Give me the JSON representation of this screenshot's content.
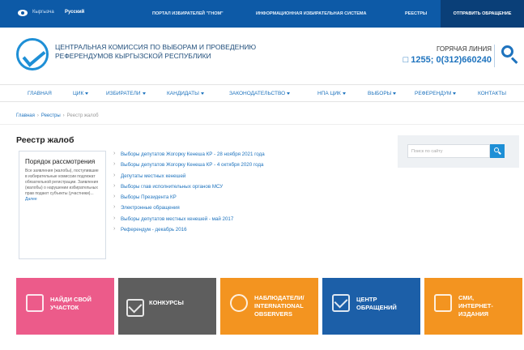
{
  "topbar": {
    "languages": [
      "Кыргызча",
      "Русский"
    ],
    "active_language": "Русский",
    "links": [
      "ПОРТАЛ ИЗБИРАТЕЛЕЙ \"ГНОМ\"",
      "ИНФОРМАЦИОННАЯ ИЗБИРАТЕЛЬНАЯ СИСТЕМА",
      "РЕЕСТРЫ"
    ],
    "send_button": "ОТПРАВИТЬ ОБРАЩЕНИЕ"
  },
  "header": {
    "org_name": "ЦЕНТРАЛЬНАЯ КОМИССИЯ ПО ВЫБОРАМ И ПРОВЕДЕНИЮ РЕФЕРЕНДУМОВ КЫРГЫЗСКОЙ РЕСПУБЛИКИ",
    "hotline_label": "ГОРЯЧАЯ ЛИНИЯ",
    "hotline_phone": "1255; 0(312)660240"
  },
  "nav": [
    {
      "label": "ГЛАВНАЯ",
      "dropdown": false
    },
    {
      "label": "ЦИК",
      "dropdown": true
    },
    {
      "label": "ИЗБИРАТЕЛИ",
      "dropdown": true
    },
    {
      "label": "КАНДИДАТЫ",
      "dropdown": true
    },
    {
      "label": "ЗАКОНОДАТЕЛЬСТВО",
      "dropdown": true
    },
    {
      "label": "НПА ЦИК",
      "dropdown": true
    },
    {
      "label": "ВЫБОРЫ",
      "dropdown": true
    },
    {
      "label": "РЕФЕРЕНДУМ",
      "dropdown": true
    },
    {
      "label": "КОНТАКТЫ",
      "dropdown": false
    }
  ],
  "breadcrumb": [
    "Главная",
    "Реестры",
    "Реестр жалоб"
  ],
  "page_title": "Реестр жалоб",
  "procedure": {
    "title": "Порядок рассмотрения",
    "text": "Все заявления (жалобы), поступившие в избирательные комиссии подлежат обязательной регистрации. Заявления (жалобы) о нарушении избирательных прав подают субъекты (участники)...",
    "more": "Далее"
  },
  "elections": [
    "Выборы депутатов Жогорку Кенеша КР - 28 ноября 2021 года",
    "Выборы депутатов Жогорку Кенеша КР - 4 октября 2020 года",
    "Депутаты местных кенешей",
    "Выборы глав исполнительных органов МСУ",
    "Выборы Президента КР",
    "Электронные обращения",
    "Выборы депутатов местных кенешей - май 2017",
    "Референдум - декабрь 2016"
  ],
  "search": {
    "placeholder": "Поиск по сайту"
  },
  "tiles": [
    {
      "label": "НАЙДИ СВОЙ\nУЧАСТОК",
      "color": "#ec5b8a"
    },
    {
      "label": "КОНКУРСЫ",
      "color": "#6f6f6f"
    },
    {
      "label": "НАБЛЮДАТЕЛИ/\nINTERNATIONAL\nOBSERVERS",
      "color": "#f39420"
    },
    {
      "label": "ЦЕНТР\nОБРАЩЕНИЙ",
      "color": "#1c5fa8"
    },
    {
      "label": "СМИ,\nИНТЕРНЕТ-\nИЗДАНИЯ",
      "color": "#f39420"
    }
  ]
}
